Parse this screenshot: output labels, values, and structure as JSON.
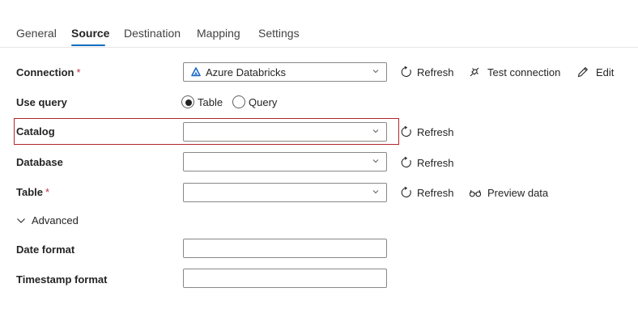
{
  "tabs": [
    "General",
    "Source",
    "Destination",
    "Mapping",
    "Settings"
  ],
  "active_tab": "Source",
  "form": {
    "connection": {
      "label": "Connection",
      "required_mark": "*",
      "value": "Azure Databricks",
      "brand_icon": "azure-databricks-icon"
    },
    "use_query": {
      "label": "Use query",
      "options": [
        "Table",
        "Query"
      ],
      "selected": "Table"
    },
    "catalog": {
      "label": "Catalog",
      "value": ""
    },
    "database": {
      "label": "Database",
      "value": ""
    },
    "table": {
      "label": "Table",
      "required_mark": "*",
      "value": ""
    },
    "advanced": {
      "label": "Advanced",
      "expanded": true
    },
    "date_format": {
      "label": "Date format",
      "value": ""
    },
    "timestamp_format": {
      "label": "Timestamp format",
      "value": ""
    }
  },
  "actions": {
    "refresh": "Refresh",
    "test_connection": "Test connection",
    "edit": "Edit",
    "preview_data": "Preview data"
  },
  "colors": {
    "accent": "#0f6cbd",
    "required": "#c4314b",
    "highlight_border": "#b3262d",
    "brand": "#1b6ac9"
  }
}
